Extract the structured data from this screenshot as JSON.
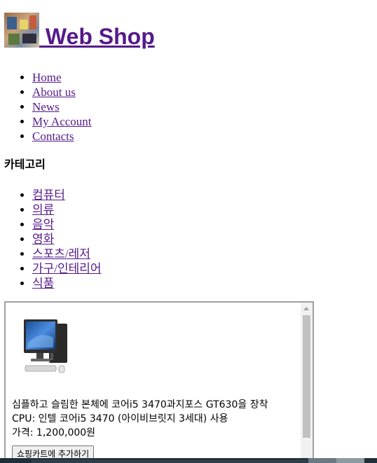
{
  "header": {
    "site_title": " Web Shop"
  },
  "nav": {
    "items": [
      {
        "label": "Home"
      },
      {
        "label": "About us"
      },
      {
        "label": "News"
      },
      {
        "label": "My Account"
      },
      {
        "label": "Contacts"
      }
    ]
  },
  "categories": {
    "heading": "카테고리",
    "items": [
      {
        "label": "컴퓨터"
      },
      {
        "label": "의류"
      },
      {
        "label": "음악"
      },
      {
        "label": "영화"
      },
      {
        "label": "스포츠/레저"
      },
      {
        "label": "가구/인테리어"
      },
      {
        "label": "식품"
      }
    ]
  },
  "product": {
    "description": "심플하고 슬림한 본체에 코어i5 3470과지포스 GT630을 장착 CPU: 인텔 코어i5 3470 (아이비브릿지 3세대) 사용",
    "price_text": "가격: 1,200,000원",
    "add_to_cart_label": "쇼핑카트에 추가하기"
  }
}
